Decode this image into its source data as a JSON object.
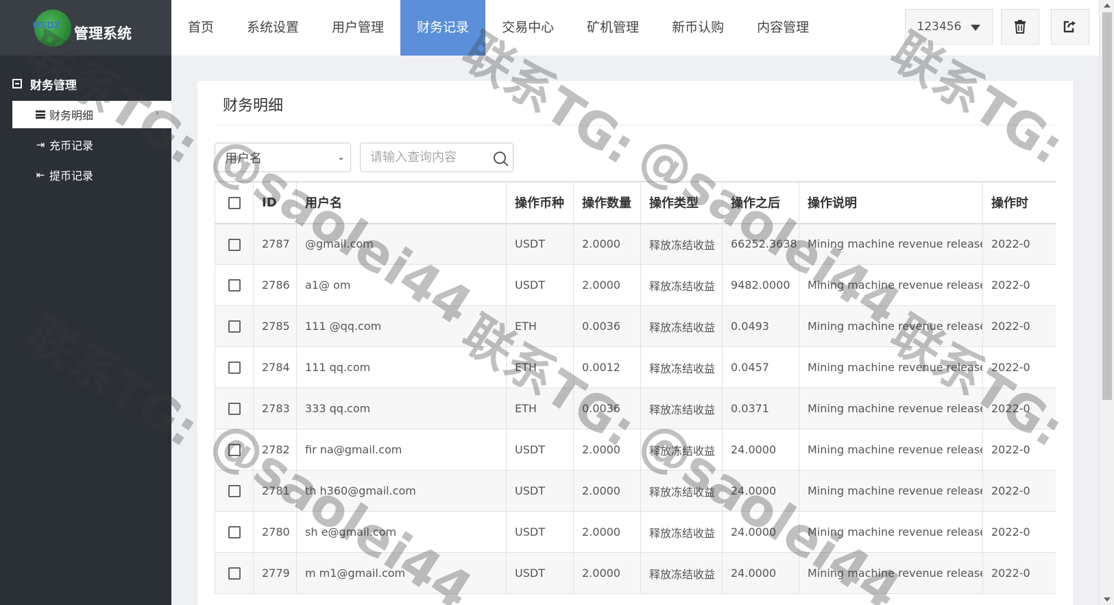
{
  "app": {
    "logo_mark": "USDZ",
    "title": "管理系统"
  },
  "sidebar": {
    "group_label": "财务管理",
    "items": [
      {
        "label": "财务明细",
        "icon": "list-icon",
        "active": true
      },
      {
        "label": "充币记录",
        "icon": "sign-in-icon"
      },
      {
        "label": "提币记录",
        "icon": "sign-out-icon"
      }
    ]
  },
  "topnav": {
    "items": [
      "首页",
      "系统设置",
      "用户管理",
      "财务记录",
      "交易中心",
      "矿机管理",
      "新币认购",
      "内容管理"
    ],
    "active_index": 3,
    "user_label": "123456",
    "icons": [
      "trash-icon",
      "logout-icon"
    ]
  },
  "page": {
    "title": "财务明细",
    "filter_select": "用户名",
    "search_placeholder": "请输入查询内容"
  },
  "table": {
    "columns": [
      "ID",
      "用户名",
      "操作币种",
      "操作数量",
      "操作类型",
      "操作之后",
      "操作说明",
      "操作时"
    ],
    "rows": [
      {
        "id": "2787",
        "user": "@gmail.com",
        "coin": "USDT",
        "amount": "2.0000",
        "type": "释放冻结收益",
        "after": "66252.3638",
        "desc": "Mining machine revenue release",
        "time": "2022-0"
      },
      {
        "id": "2786",
        "user": "a1@ om",
        "coin": "USDT",
        "amount": "2.0000",
        "type": "释放冻结收益",
        "after": "9482.0000",
        "desc": "Mining machine revenue release",
        "time": "2022-0"
      },
      {
        "id": "2785",
        "user": "111 @qq.com",
        "coin": "ETH",
        "amount": "0.0036",
        "type": "释放冻结收益",
        "after": "0.0493",
        "desc": "Mining machine revenue release",
        "time": "2022-0"
      },
      {
        "id": "2784",
        "user": "111 qq.com",
        "coin": "ETH",
        "amount": "0.0012",
        "type": "释放冻结收益",
        "after": "0.0457",
        "desc": "Mining machine revenue release",
        "time": "2022-0"
      },
      {
        "id": "2783",
        "user": "333 qq.com",
        "coin": "ETH",
        "amount": "0.0036",
        "type": "释放冻结收益",
        "after": "0.0371",
        "desc": "Mining machine revenue release",
        "time": "2022-0"
      },
      {
        "id": "2782",
        "user": "fir na@gmail.com",
        "coin": "USDT",
        "amount": "2.0000",
        "type": "释放冻结收益",
        "after": "24.0000",
        "desc": "Mining machine revenue release",
        "time": "2022-0"
      },
      {
        "id": "2781",
        "user": "th h360@gmail.com",
        "coin": "USDT",
        "amount": "2.0000",
        "type": "释放冻结收益",
        "after": "24.0000",
        "desc": "Mining machine revenue release",
        "time": "2022-0"
      },
      {
        "id": "2780",
        "user": "sh e@gmail.com",
        "coin": "USDT",
        "amount": "2.0000",
        "type": "释放冻结收益",
        "after": "24.0000",
        "desc": "Mining machine revenue release",
        "time": "2022-0"
      },
      {
        "id": "2779",
        "user": "m m1@gmail.com",
        "coin": "USDT",
        "amount": "2.0000",
        "type": "释放冻结收益",
        "after": "24.0000",
        "desc": "Mining machine revenue release",
        "time": "2022-0"
      }
    ]
  },
  "watermarks": {
    "tg": "联系TG:",
    "handle": "@saolei44"
  }
}
